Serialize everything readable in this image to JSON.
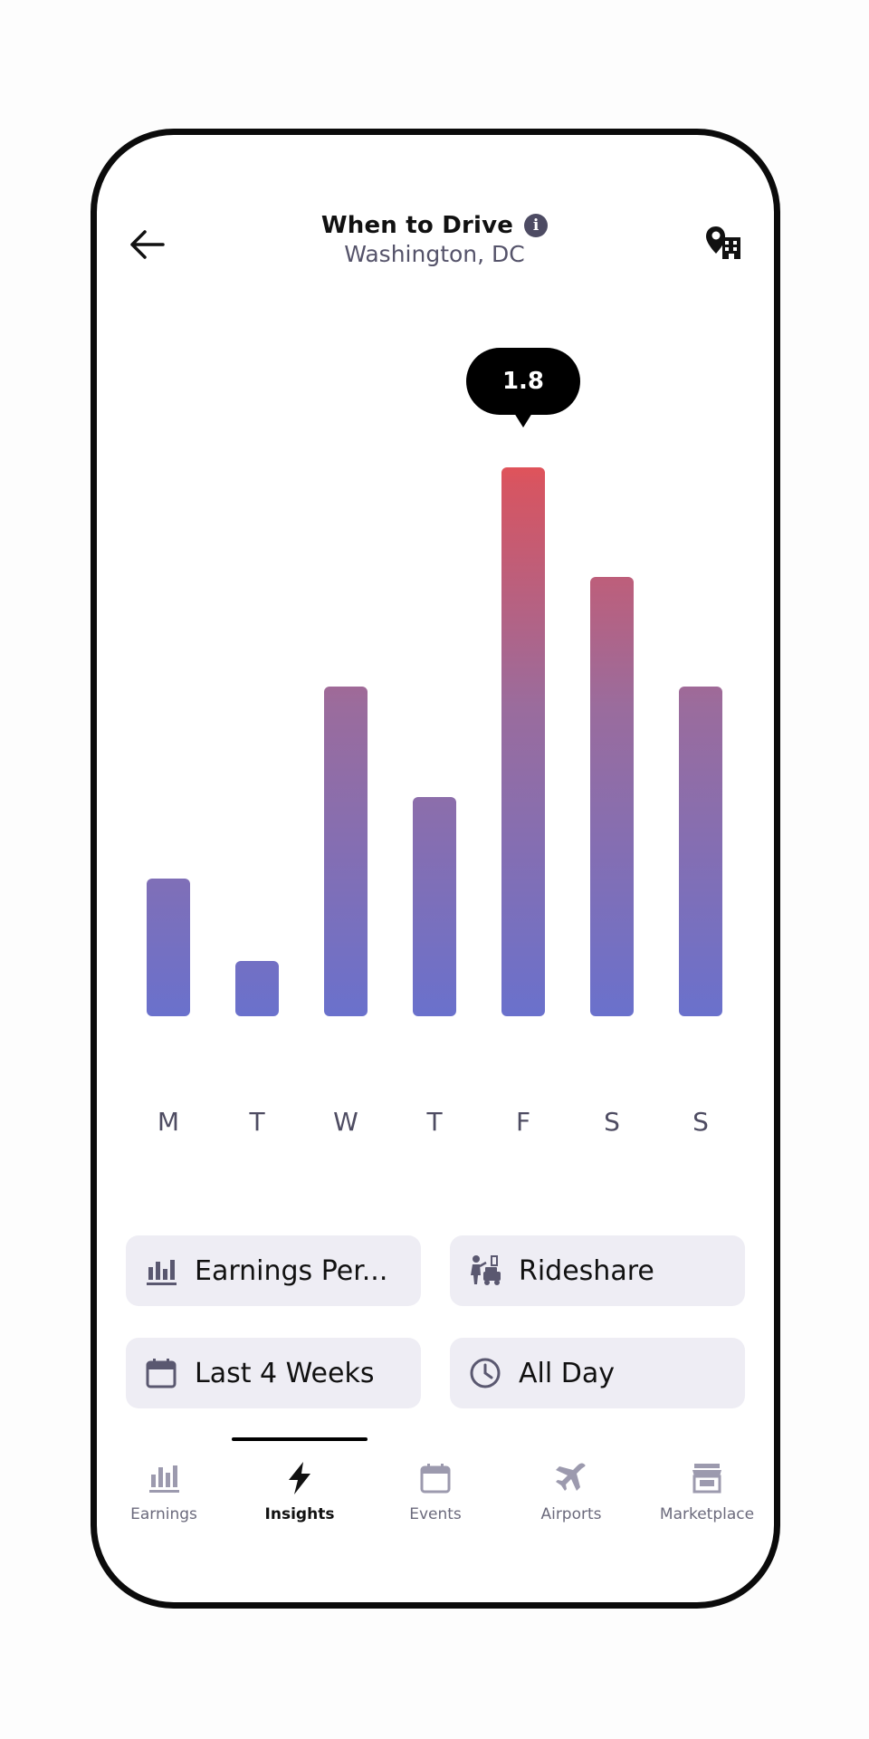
{
  "header": {
    "title": "When to Drive",
    "subtitle": "Washington, DC",
    "info_icon": "i"
  },
  "chart_data": {
    "type": "bar",
    "categories": [
      "M",
      "T",
      "W",
      "T",
      "F",
      "S",
      "S"
    ],
    "values": [
      0.45,
      0.18,
      1.08,
      0.72,
      1.8,
      1.44,
      1.08
    ],
    "selected_index": 4,
    "tooltip": "1.8",
    "colors": {
      "bottom": "#6a71cc",
      "top": "#e0535a"
    }
  },
  "filters": {
    "metric": "Earnings Per...",
    "service": "Rideshare",
    "period": "Last 4 Weeks",
    "time": "All Day"
  },
  "nav": {
    "items": [
      {
        "label": "Earnings",
        "icon": "bar-chart-icon"
      },
      {
        "label": "Insights",
        "icon": "lightning-icon"
      },
      {
        "label": "Events",
        "icon": "calendar-icon"
      },
      {
        "label": "Airports",
        "icon": "airplane-icon"
      },
      {
        "label": "Marketplace",
        "icon": "storefront-icon"
      }
    ],
    "active": "Insights"
  }
}
